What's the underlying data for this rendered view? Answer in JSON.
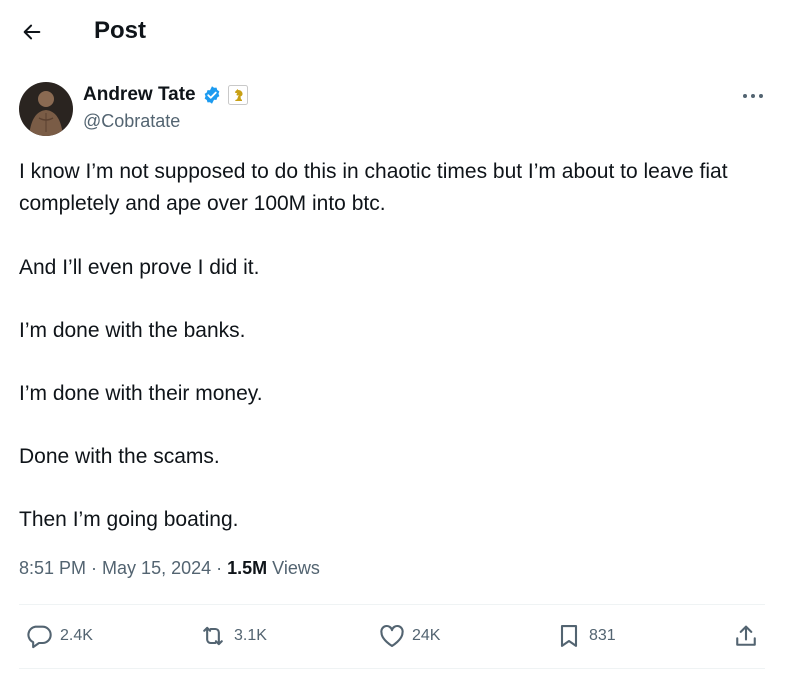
{
  "header": {
    "title": "Post",
    "back_icon": "arrow-left-icon"
  },
  "author": {
    "name": "Andrew Tate",
    "handle": "@Cobratate",
    "verified_color": "#1d9bf0",
    "affiliate_icon": "chess-piece-icon"
  },
  "post": {
    "paragraphs": [
      "I know I’m not supposed to do this in chaotic times but I’m about to leave fiat completely and ape over 100M into btc.",
      "And I’ll even prove I did it.",
      "I’m done with the banks.",
      "I’m done with their money.",
      "Done with the scams.",
      "Then I’m going boating."
    ]
  },
  "meta": {
    "time": "8:51 PM",
    "sep1": "·",
    "date": "May 15, 2024",
    "sep2": "·",
    "views_count": "1.5M",
    "views_label": "Views"
  },
  "actions": {
    "replies": "2.4K",
    "reposts": "3.1K",
    "likes": "24K",
    "bookmarks": "831"
  },
  "colors": {
    "text": "#0f1419",
    "secondary": "#536471",
    "divider": "#eff3f4",
    "accent": "#1d9bf0"
  }
}
